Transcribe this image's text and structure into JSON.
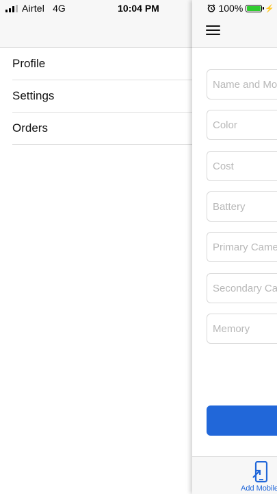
{
  "status_bar": {
    "carrier": "Airtel",
    "network": "4G",
    "time": "10:04 PM",
    "battery_percent": "100%",
    "battery_level": 1.0,
    "battery_color": "#2ecc2e"
  },
  "drawer": {
    "items": [
      {
        "label": "Profile"
      },
      {
        "label": "Settings"
      },
      {
        "label": "Orders"
      }
    ]
  },
  "form": {
    "fields": [
      {
        "placeholder": "Name and Model",
        "value": ""
      },
      {
        "placeholder": "Color",
        "value": ""
      },
      {
        "placeholder": "Cost",
        "value": ""
      },
      {
        "placeholder": "Battery",
        "value": ""
      },
      {
        "placeholder": "Primary Camera",
        "value": ""
      },
      {
        "placeholder": "Secondary Camera",
        "value": ""
      },
      {
        "placeholder": "Memory",
        "value": ""
      }
    ],
    "button_color": "#2167d9"
  },
  "tab_bar": {
    "add_tab_label": "Add Mobile",
    "add_tab_icon": "add-phone-icon",
    "accent": "#2167d9"
  }
}
